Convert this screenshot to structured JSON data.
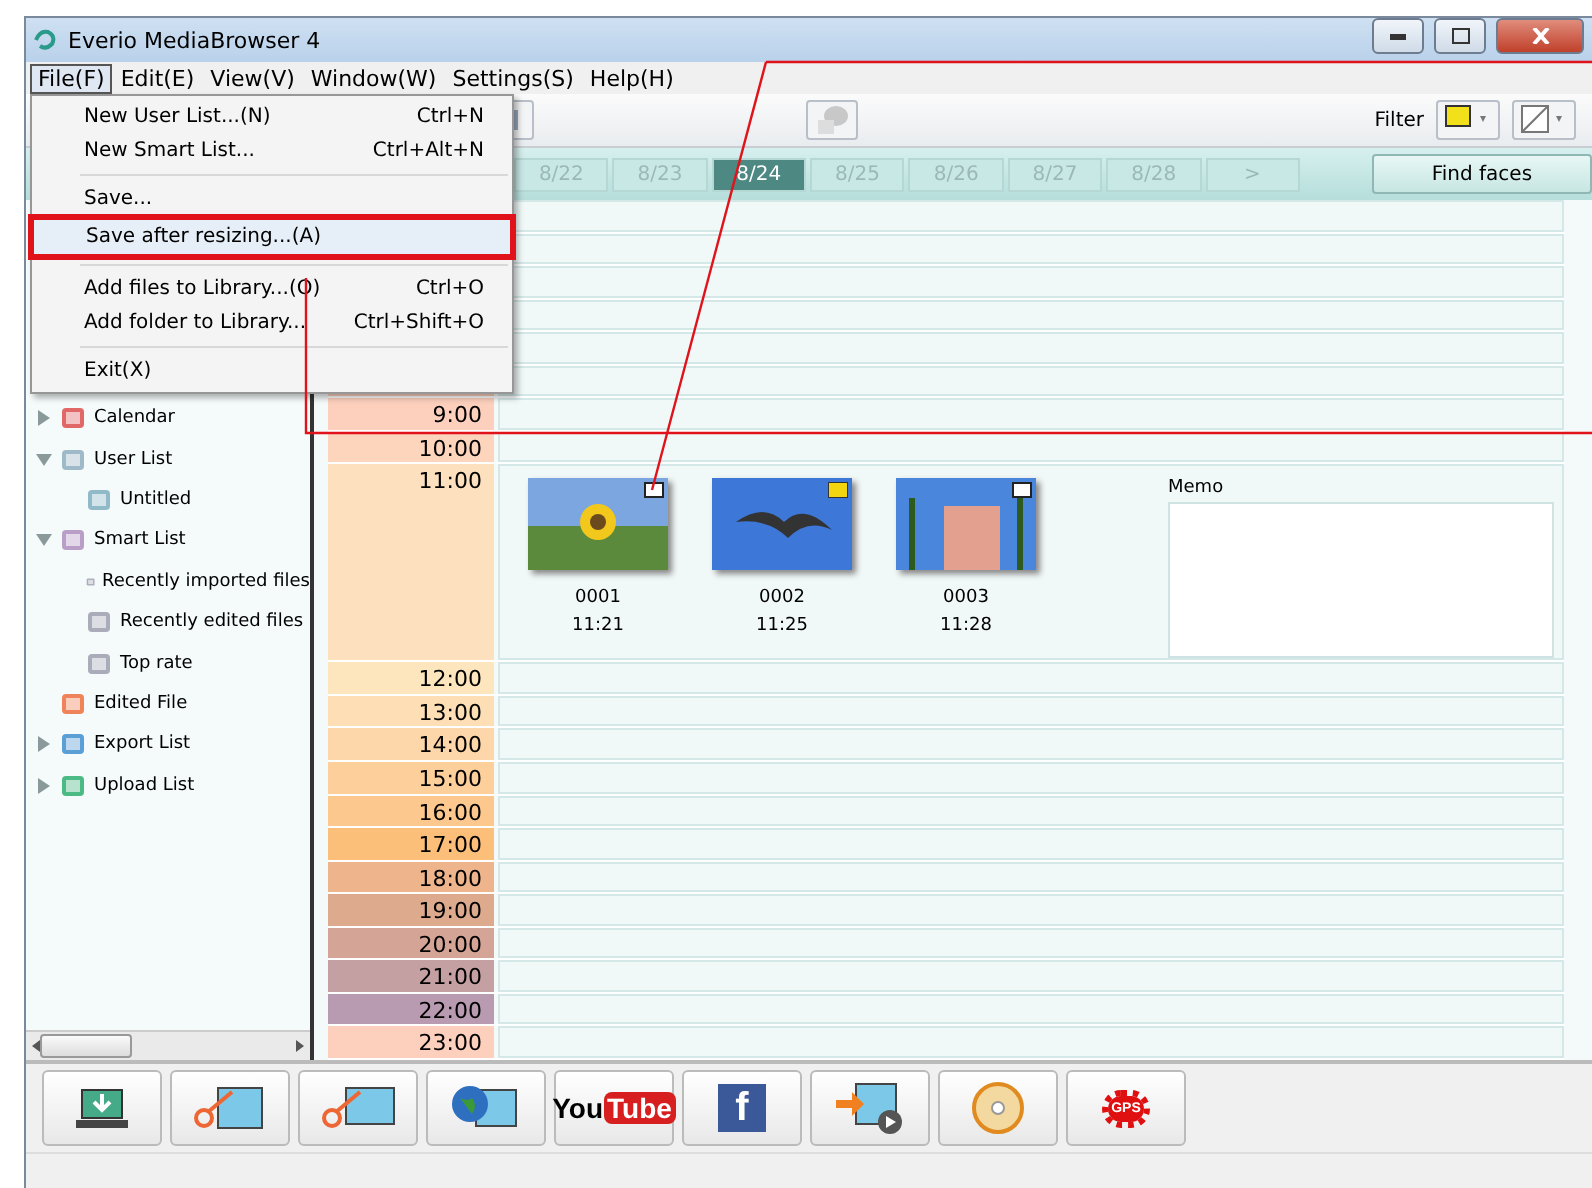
{
  "window": {
    "title": "Everio MediaBrowser 4"
  },
  "menu_bar": [
    {
      "label": "File(F)",
      "selected": true
    },
    {
      "label": "Edit(E)",
      "selected": false
    },
    {
      "label": "View(V)",
      "selected": false
    },
    {
      "label": "Window(W)",
      "selected": false
    },
    {
      "label": "Settings(S)",
      "selected": false
    },
    {
      "label": "Help(H)",
      "selected": false
    }
  ],
  "file_menu": [
    {
      "kind": "item",
      "label": "New User List...(N)",
      "shortcut": "Ctrl+N",
      "selected": false
    },
    {
      "kind": "item",
      "label": "New Smart List...",
      "shortcut": "Ctrl+Alt+N",
      "selected": false
    },
    {
      "kind": "separator"
    },
    {
      "kind": "item",
      "label": "Save...",
      "selected": false
    },
    {
      "kind": "item",
      "label": "Save after resizing...(A)",
      "selected": true
    },
    {
      "kind": "separator"
    },
    {
      "kind": "item",
      "label": "Add files to Library...(O)",
      "shortcut": "Ctrl+O",
      "selected": false
    },
    {
      "kind": "item",
      "label": "Add folder to Library...",
      "shortcut": "Ctrl+Shift+O",
      "selected": false
    },
    {
      "kind": "separator"
    },
    {
      "kind": "item",
      "label": "Exit(X)",
      "selected": false
    }
  ],
  "toolbar": {
    "filter_label": "Filter"
  },
  "date_tabs": [
    {
      "label": "8/22",
      "selected": false
    },
    {
      "label": "8/23",
      "selected": false
    },
    {
      "label": "8/24",
      "selected": true
    },
    {
      "label": "8/25",
      "selected": false
    },
    {
      "label": "8/26",
      "selected": false
    },
    {
      "label": "8/27",
      "selected": false
    },
    {
      "label": "8/28",
      "selected": false
    },
    {
      "label": ">",
      "selected": false
    }
  ],
  "find_faces": "Find faces",
  "sidebar": [
    {
      "label": "Calendar",
      "expanded": false
    },
    {
      "label": "User List",
      "expanded": true,
      "children": [
        {
          "label": "Untitled"
        }
      ]
    },
    {
      "label": "Smart List",
      "expanded": true,
      "children": [
        {
          "label": "Recently imported files"
        },
        {
          "label": "Recently edited files"
        },
        {
          "label": "Top rate"
        }
      ]
    },
    {
      "label": "Edited File"
    },
    {
      "label": "Export List",
      "expanded": false
    },
    {
      "label": "Upload List",
      "expanded": false
    }
  ],
  "hours": [
    {
      "time": "9:00"
    },
    {
      "time": "10:00"
    },
    {
      "time": "11:00",
      "memo_label": "Memo",
      "clips": [
        {
          "number": "0001",
          "time": "11:21",
          "kind": "still"
        },
        {
          "number": "0002",
          "time": "11:25",
          "kind": "video"
        },
        {
          "number": "0003",
          "time": "11:28",
          "kind": "still"
        }
      ]
    },
    {
      "time": "12:00"
    },
    {
      "time": "13:00"
    },
    {
      "time": "14:00"
    },
    {
      "time": "15:00"
    },
    {
      "time": "16:00"
    },
    {
      "time": "17:00"
    },
    {
      "time": "18:00"
    },
    {
      "time": "19:00"
    },
    {
      "time": "20:00"
    },
    {
      "time": "21:00"
    },
    {
      "time": "22:00"
    },
    {
      "time": "23:00"
    }
  ],
  "bottom_toolbar": [
    {
      "kind": "import"
    },
    {
      "kind": "edit-video"
    },
    {
      "kind": "trim"
    },
    {
      "kind": "web"
    },
    {
      "kind": "youtube",
      "text": [
        "You",
        "Tube"
      ]
    },
    {
      "kind": "facebook",
      "text": [
        "f"
      ]
    },
    {
      "kind": "export"
    },
    {
      "kind": "disc"
    },
    {
      "kind": "gps",
      "text": [
        "GPS"
      ]
    }
  ]
}
